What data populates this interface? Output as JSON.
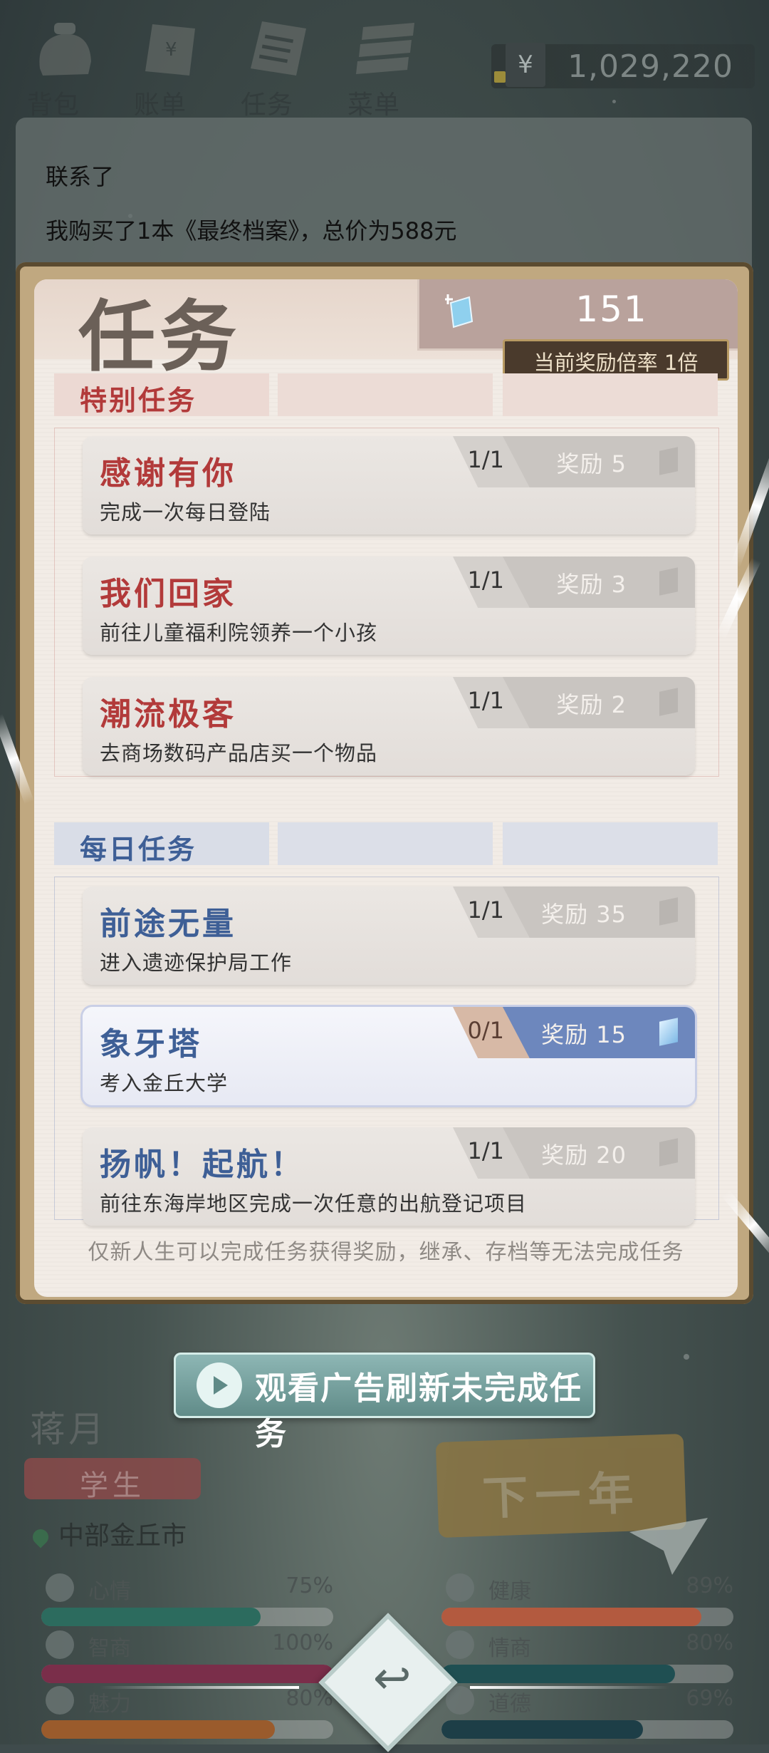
{
  "topbar": {
    "items": [
      {
        "label": "背包",
        "icon": "backpack-icon"
      },
      {
        "label": "账单",
        "icon": "bill-icon"
      },
      {
        "label": "任务",
        "icon": "task-icon"
      },
      {
        "label": "菜单",
        "icon": "menu-icon"
      }
    ],
    "currency_symbol": "¥",
    "money": "1,029,220"
  },
  "log": {
    "lines": [
      "联系了",
      "我购买了1本《最终档案》，总价为588元"
    ]
  },
  "modal": {
    "title": "任务",
    "gems": "151",
    "reward_rate": "当前奖励倍率 1倍",
    "special_section": "特别任务",
    "daily_section": "每日任务",
    "special_tasks": [
      {
        "title": "感谢有你",
        "desc": "完成一次每日登陆",
        "progress": "1/1",
        "reward": "奖励 5"
      },
      {
        "title": "我们回家",
        "desc": "前往儿童福利院领养一个小孩",
        "progress": "1/1",
        "reward": "奖励 3"
      },
      {
        "title": "潮流极客",
        "desc": "去商场数码产品店买一个物品",
        "progress": "1/1",
        "reward": "奖励 2"
      }
    ],
    "daily_tasks": [
      {
        "title": "前途无量",
        "desc": "进入遗迹保护局工作",
        "progress": "1/1",
        "reward": "奖励 35"
      },
      {
        "title": "象牙塔",
        "desc": "考入金丘大学",
        "progress": "0/1",
        "reward": "奖励 15"
      },
      {
        "title": "扬帆！起航！",
        "desc": "前往东海岸地区完成一次任意的出航登记项目",
        "progress": "1/1",
        "reward": "奖励 20"
      }
    ],
    "footnote": "仅新人生可以完成任务获得奖励，继承、存档等无法完成任务"
  },
  "ad_button": "观看广告刷新未完成任务",
  "character": {
    "name": "蒋月",
    "role": "学生",
    "location": "中部金丘市",
    "next_year": "下一年"
  },
  "stats": [
    {
      "label": "心情",
      "value": "75%",
      "fraction": 0.75,
      "color": "#2c6b5e",
      "icon": "mood-icon"
    },
    {
      "label": "健康",
      "value": "89%",
      "fraction": 0.89,
      "color": "#b35a3f",
      "icon": "heart-icon"
    },
    {
      "label": "智商",
      "value": "100%",
      "fraction": 1.0,
      "color": "#7a2e4a",
      "icon": "brain-icon"
    },
    {
      "label": "情商",
      "value": "80%",
      "fraction": 0.8,
      "color": "#1f4f52",
      "icon": "apple-icon"
    },
    {
      "label": "魅力",
      "value": "80%",
      "fraction": 0.8,
      "color": "#9a5b2c",
      "icon": "star-icon"
    },
    {
      "label": "道德",
      "value": "69%",
      "fraction": 0.69,
      "color": "#1d3e47",
      "icon": "scale-icon"
    }
  ],
  "colors": {
    "special_title": "#b23a3a",
    "daily_title": "#3e5f96",
    "special_tab_bg": "#ecd9d3",
    "daily_tab_bg": "#d9dde7"
  }
}
